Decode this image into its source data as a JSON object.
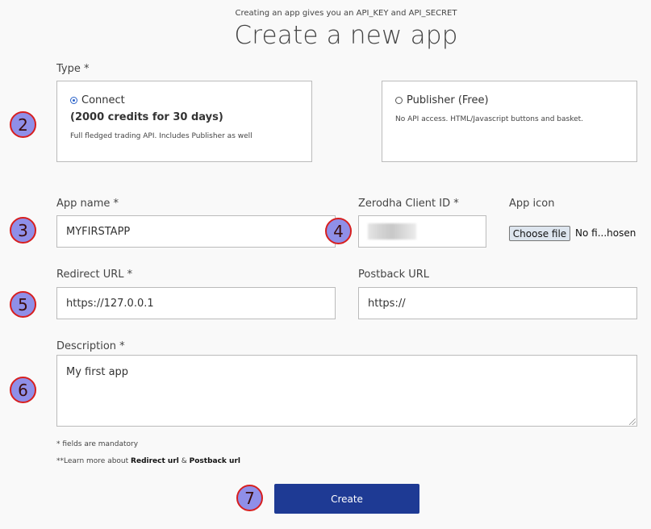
{
  "header": {
    "subtitle": "Creating an app gives you an API_KEY and API_SECRET",
    "title": "Create a new app"
  },
  "type": {
    "label": "Type *",
    "connect": {
      "label": "Connect",
      "credits": "(2000 credits for 30 days)",
      "description": "Full fledged trading API. Includes Publisher as well",
      "selected": true
    },
    "publisher": {
      "label": "Publisher (Free)",
      "description": "No API access. HTML/Javascript buttons and basket.",
      "selected": false
    }
  },
  "fields": {
    "app_name": {
      "label": "App name *",
      "value": "MYFIRSTAPP"
    },
    "client_id": {
      "label": "Zerodha Client ID *",
      "value": ""
    },
    "app_icon": {
      "label": "App icon",
      "button": "Choose file",
      "status": "No fi...hosen"
    },
    "redirect_url": {
      "label": "Redirect URL *",
      "value": "https://127.0.0.1"
    },
    "postback_url": {
      "label": "Postback URL",
      "value": "https://"
    },
    "description": {
      "label": "Description *",
      "value": "My first app"
    }
  },
  "notes": {
    "mandatory": "* fields are mandatory",
    "learn_prefix": "**Learn more about",
    "redirect_link": "Redirect url",
    "amp": "&",
    "postback_link": "Postback url"
  },
  "submit": {
    "label": "Create"
  },
  "annotations": [
    "2",
    "3",
    "4",
    "5",
    "6",
    "7"
  ],
  "colors": {
    "primary_button": "#1e3a94",
    "badge_fill": "#8f8fe8",
    "badge_border": "#d71f1f",
    "radio_selected": "#2a62c9"
  }
}
